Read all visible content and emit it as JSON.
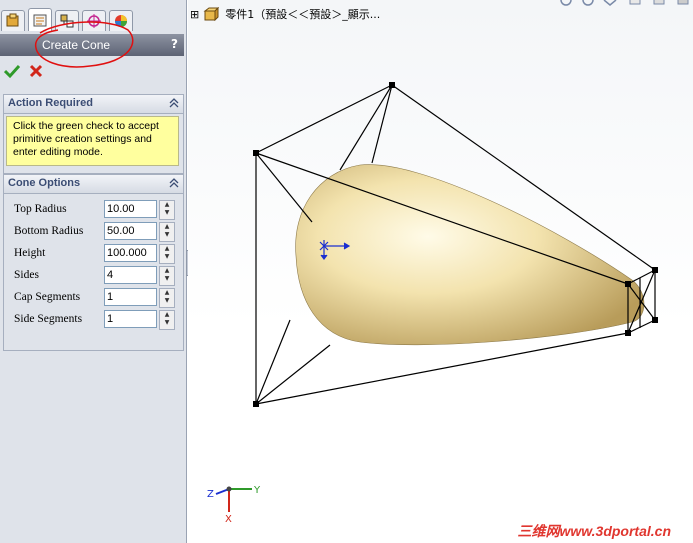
{
  "tabs": [
    {
      "icon": "feature-manager-icon",
      "active": false
    },
    {
      "icon": "property-manager-icon",
      "active": true
    },
    {
      "icon": "configuration-manager-icon",
      "active": false
    },
    {
      "icon": "dimxpert-icon",
      "active": false
    },
    {
      "icon": "appearance-icon",
      "active": false
    }
  ],
  "panel": {
    "title": "Create Cone",
    "help": "?"
  },
  "actions": {
    "ok_icon": "green-check-icon",
    "cancel_icon": "red-x-icon"
  },
  "action_required": {
    "title": "Action Required",
    "message": "Click the green check to accept primitive creation settings and enter editing mode."
  },
  "cone_options": {
    "title": "Cone Options",
    "fields": [
      {
        "label": "Top Radius",
        "value": "10.00"
      },
      {
        "label": "Bottom Radius",
        "value": "50.00"
      },
      {
        "label": "Height",
        "value": "100.000"
      },
      {
        "label": "Sides",
        "value": "4"
      },
      {
        "label": "Cap Segments",
        "value": "1"
      },
      {
        "label": "Side Segments",
        "value": "1"
      }
    ]
  },
  "tree": {
    "expand": "⊞",
    "label": "零件1（預設＜＜預設＞_顯示..."
  },
  "triad": {
    "x": "X",
    "y": "Y",
    "z": "Z"
  },
  "watermark": "三维网www.3dportal.cn",
  "colors": {
    "shape_fill": "#f2e0a8",
    "annotation": "#e01010",
    "accent": "#3b4d74"
  }
}
